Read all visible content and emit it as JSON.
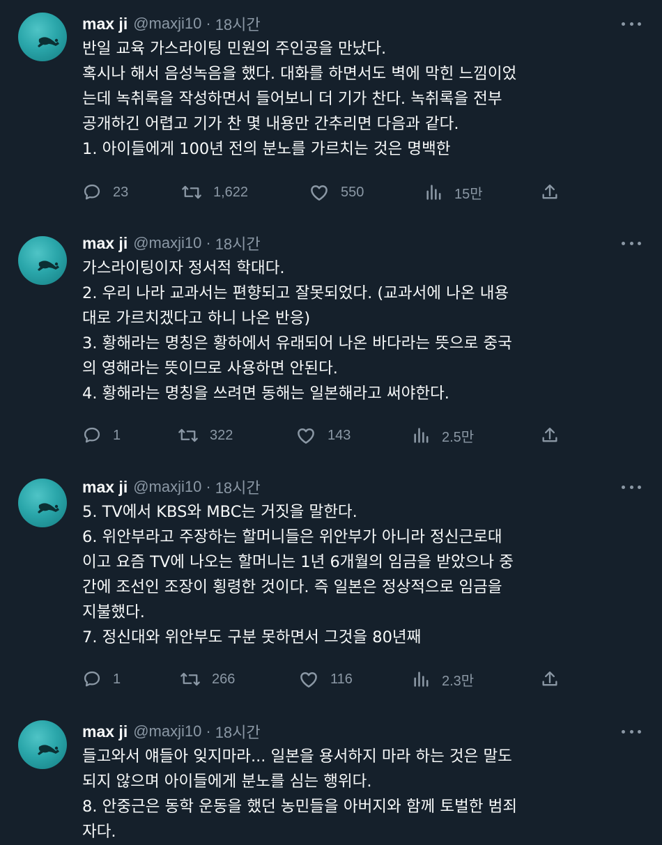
{
  "tweets": [
    {
      "author": {
        "name": "max ji",
        "handle": "@maxji10",
        "separator": "·",
        "time": "18시간"
      },
      "lines": [
        "반일 교육 가스라이팅 민원의 주인공을 만났다.",
        "혹시나 해서 음성녹음을 했다. 대화를 하면서도 벽에 막힌 느낌이었",
        "는데 녹취록을 작성하면서 들어보니 더 기가 찬다. 녹취록을 전부",
        "공개하긴 어렵고 기가 찬 몇 내용만 간추리면 다음과 같다.",
        "1. 아이들에게 100년 전의 분노를 가르치는 것은 명백한"
      ],
      "stats": {
        "replies": "23",
        "retweets": "1,622",
        "likes": "550",
        "views": "15만"
      }
    },
    {
      "author": {
        "name": "max ji",
        "handle": "@maxji10",
        "separator": "·",
        "time": "18시간"
      },
      "lines": [
        "가스라이팅이자 정서적 학대다.",
        "2. 우리 나라 교과서는 편향되고 잘못되었다. (교과서에 나온 내용",
        "대로 가르치겠다고 하니 나온 반응)",
        "3. 황해라는 명칭은 황하에서 유래되어 나온 바다라는 뜻으로 중국",
        "의 영해라는 뜻이므로 사용하면 안된다.",
        "4. 황해라는 명칭을 쓰려면 동해는 일본해라고 써야한다."
      ],
      "stats": {
        "replies": "1",
        "retweets": "322",
        "likes": "143",
        "views": "2.5만"
      }
    },
    {
      "author": {
        "name": "max ji",
        "handle": "@maxji10",
        "separator": "·",
        "time": "18시간"
      },
      "lines": [
        "5. TV에서 KBS와 MBC는 거짓을 말한다.",
        "6. 위안부라고 주장하는 할머니들은 위안부가 아니라 정신근로대",
        "이고 요즘 TV에 나오는 할머니는 1년 6개월의 임금을 받았으나 중",
        "간에 조선인 조장이 횡령한 것이다. 즉 일본은 정상적으로 임금을",
        "지불했다.",
        "7. 정신대와 위안부도 구분 못하면서 그것을 80년째"
      ],
      "stats": {
        "replies": "1",
        "retweets": "266",
        "likes": "116",
        "views": "2.3만"
      }
    },
    {
      "author": {
        "name": "max ji",
        "handle": "@maxji10",
        "separator": "·",
        "time": "18시간"
      },
      "lines": [
        "들고와서 얘들아 잊지마라... 일본을 용서하지 마라 하는 것은 말도",
        "되지 않으며 아이들에게 분노를 심는 행위다.",
        "8. 안중근은 동학 운동을 했던 농민들을 아버지와 함께 토벌한 범죄",
        "자다."
      ],
      "stats": null
    }
  ],
  "icons": {
    "reply": "speech-bubble-icon",
    "retweet": "retweet-arrows-icon",
    "like": "heart-icon",
    "views": "bar-chart-icon",
    "share": "share-upload-icon",
    "more": "more-dots-icon"
  },
  "colors": {
    "background": "#15202b",
    "text_primary": "#f7f9f9",
    "text_secondary": "#8b98a5",
    "avatar": "#2aa6aa"
  }
}
